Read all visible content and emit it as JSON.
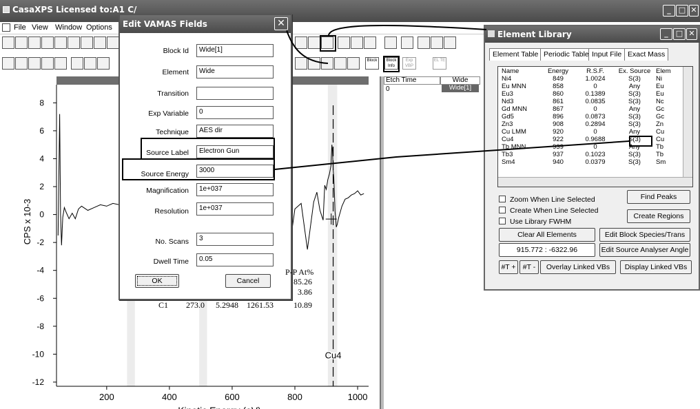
{
  "main_window": {
    "title": "CasaXPS Licensed to:A1 C/",
    "menu": [
      "File",
      "View",
      "Window",
      "Options"
    ]
  },
  "toolbar_right_labels": {
    "block_info": "Block Info",
    "block_label": "Block",
    "exp_vbp": "Exp VBP",
    "el_te": "EL TE"
  },
  "browser": {
    "col1": "Etch Time",
    "col2": "Wide",
    "row_etch": "0",
    "row_block": "Wide[1]"
  },
  "dialog": {
    "title": "Edit VAMAS Fields",
    "fields": {
      "block_id": {
        "label": "Block Id",
        "value": "Wide[1]"
      },
      "element": {
        "label": "Element",
        "value": "Wide"
      },
      "transition": {
        "label": "Transition",
        "value": ""
      },
      "exp_variable": {
        "label": "Exp Variable",
        "value": "0"
      },
      "technique": {
        "label": "Technique",
        "value": "AES dir"
      },
      "source_label": {
        "label": "Source Label",
        "value": "Electron Gun"
      },
      "source_energy": {
        "label": "Source Energy",
        "value": "3000"
      },
      "magnification": {
        "label": "Magnification",
        "value": "1e+037"
      },
      "resolution": {
        "label": "Resolution",
        "value": "1e+037"
      },
      "no_scans": {
        "label": "No. Scans",
        "value": "3"
      },
      "dwell_time": {
        "label": "Dwell Time",
        "value": "0.05"
      }
    },
    "ok_label": "OK",
    "cancel_label": "Cancel"
  },
  "quant_table": {
    "header": "P-P At%",
    "rows": [
      {
        "name": "",
        "pos": "",
        "rsf": "",
        "area": "",
        "at": "85.26"
      },
      {
        "name": "",
        "pos": "",
        "rsf": "",
        "area": "",
        "at": "3.86"
      },
      {
        "name": "C1",
        "pos": "273.0",
        "rsf": "5.2948",
        "area": "1261.53",
        "at": "10.89"
      }
    ]
  },
  "element_library": {
    "title": "Element Library",
    "tabs": [
      "Element Table",
      "Periodic Table",
      "Input File",
      "Exact Mass"
    ],
    "columns": [
      "Name",
      "Energy",
      "R.S.F.",
      "Ex. Source",
      "Elem"
    ],
    "rows": [
      [
        "Ni4",
        "849",
        "1.0024",
        "S(3)",
        "Ni"
      ],
      [
        "Eu MNN",
        "858",
        "0",
        "Any",
        "Eu"
      ],
      [
        "Eu3",
        "860",
        "0.1389",
        "S(3)",
        "Eu"
      ],
      [
        "Nd3",
        "861",
        "0.0835",
        "S(3)",
        "Nc"
      ],
      [
        "Gd MNN",
        "867",
        "0",
        "Any",
        "Gc"
      ],
      [
        "Gd5",
        "896",
        "0.0873",
        "S(3)",
        "Gc"
      ],
      [
        "Zn3",
        "908",
        "0.2894",
        "S(3)",
        "Zn"
      ],
      [
        "Cu LMM",
        "920",
        "0",
        "Any",
        "Cu"
      ],
      [
        "Cu4",
        "922",
        "0.9688",
        "S(3)",
        "Cu"
      ],
      [
        "Tb MNN",
        "939",
        "0",
        "Any",
        "Tb"
      ],
      [
        "Tb3",
        "937",
        "0.1023",
        "S(3)",
        "Tb"
      ],
      [
        "Sm4",
        "940",
        "0.0379",
        "S(3)",
        "Sm"
      ]
    ],
    "zoom_label": "Zoom When Line Selected",
    "create_label": "Create When Line Selected",
    "fwhm_label": "Use Library FWHM",
    "find_peaks": "Find Peaks",
    "create_regions": "Create Regions",
    "clear_all": "Clear All Elements",
    "edit_block": "Edit Block Species/Trans",
    "readout": "915.772 : -6322.96",
    "edit_source": "Edit Source Analyser Angle",
    "t_plus": "#T +",
    "t_minus": "#T -",
    "overlay": "Overlay Linked VBs",
    "display": "Display Linked VBs"
  },
  "chart_data": {
    "type": "line",
    "xlabel": "Kinetic Energy (eV)",
    "ylabel": "CPS x 10-3",
    "xlim": [
      40,
      1035
    ],
    "ylim": [
      -12.3,
      9.3
    ],
    "xticks": [
      "200",
      "400",
      "600",
      "800",
      "1000"
    ],
    "yticks": [
      "8",
      "6",
      "4",
      "2",
      "0",
      "-2",
      "-4",
      "-6",
      "-8",
      "-10",
      "-12"
    ],
    "annotation": "Cu4",
    "marker_x": 922,
    "series": [
      {
        "x": [
          45,
          50,
          53,
          56,
          60,
          65,
          70,
          80,
          90,
          100,
          110,
          120,
          140,
          160,
          180,
          200,
          220,
          240,
          260,
          280,
          300,
          330,
          360,
          400,
          500,
          600,
          700,
          740,
          760,
          770,
          775,
          780,
          790,
          800,
          820,
          840,
          860,
          870,
          880,
          890,
          895,
          900,
          905,
          910,
          915,
          918,
          920,
          922,
          924,
          926,
          928,
          930,
          932,
          935,
          940,
          950,
          960,
          970,
          980,
          990,
          1000,
          1010,
          1020
        ],
        "y": [
          -1.5,
          7.2,
          0.0,
          -2.2,
          -0.2,
          0.5,
          0.2,
          -0.3,
          0.1,
          -0.3,
          0.4,
          0.6,
          0.3,
          0.5,
          0.7,
          0.6,
          0.8,
          0.7,
          0.9,
          1.1,
          1.0,
          1.1,
          1.2,
          1.2,
          1.2,
          1.2,
          1.2,
          1.0,
          0.7,
          1.4,
          1.8,
          0.6,
          -1.2,
          0.4,
          0.8,
          -2.5,
          0.9,
          1.6,
          0.3,
          -0.4,
          2.1,
          1.8,
          2.5,
          2.9,
          3.5,
          5.0,
          4.6,
          3.2,
          2.6,
          1.5,
          0.2,
          -0.3,
          -0.9,
          -0.7,
          -0.2,
          0.6,
          1.1,
          1.2,
          1.4,
          1.5,
          1.7,
          1.4,
          1.5
        ]
      }
    ]
  }
}
